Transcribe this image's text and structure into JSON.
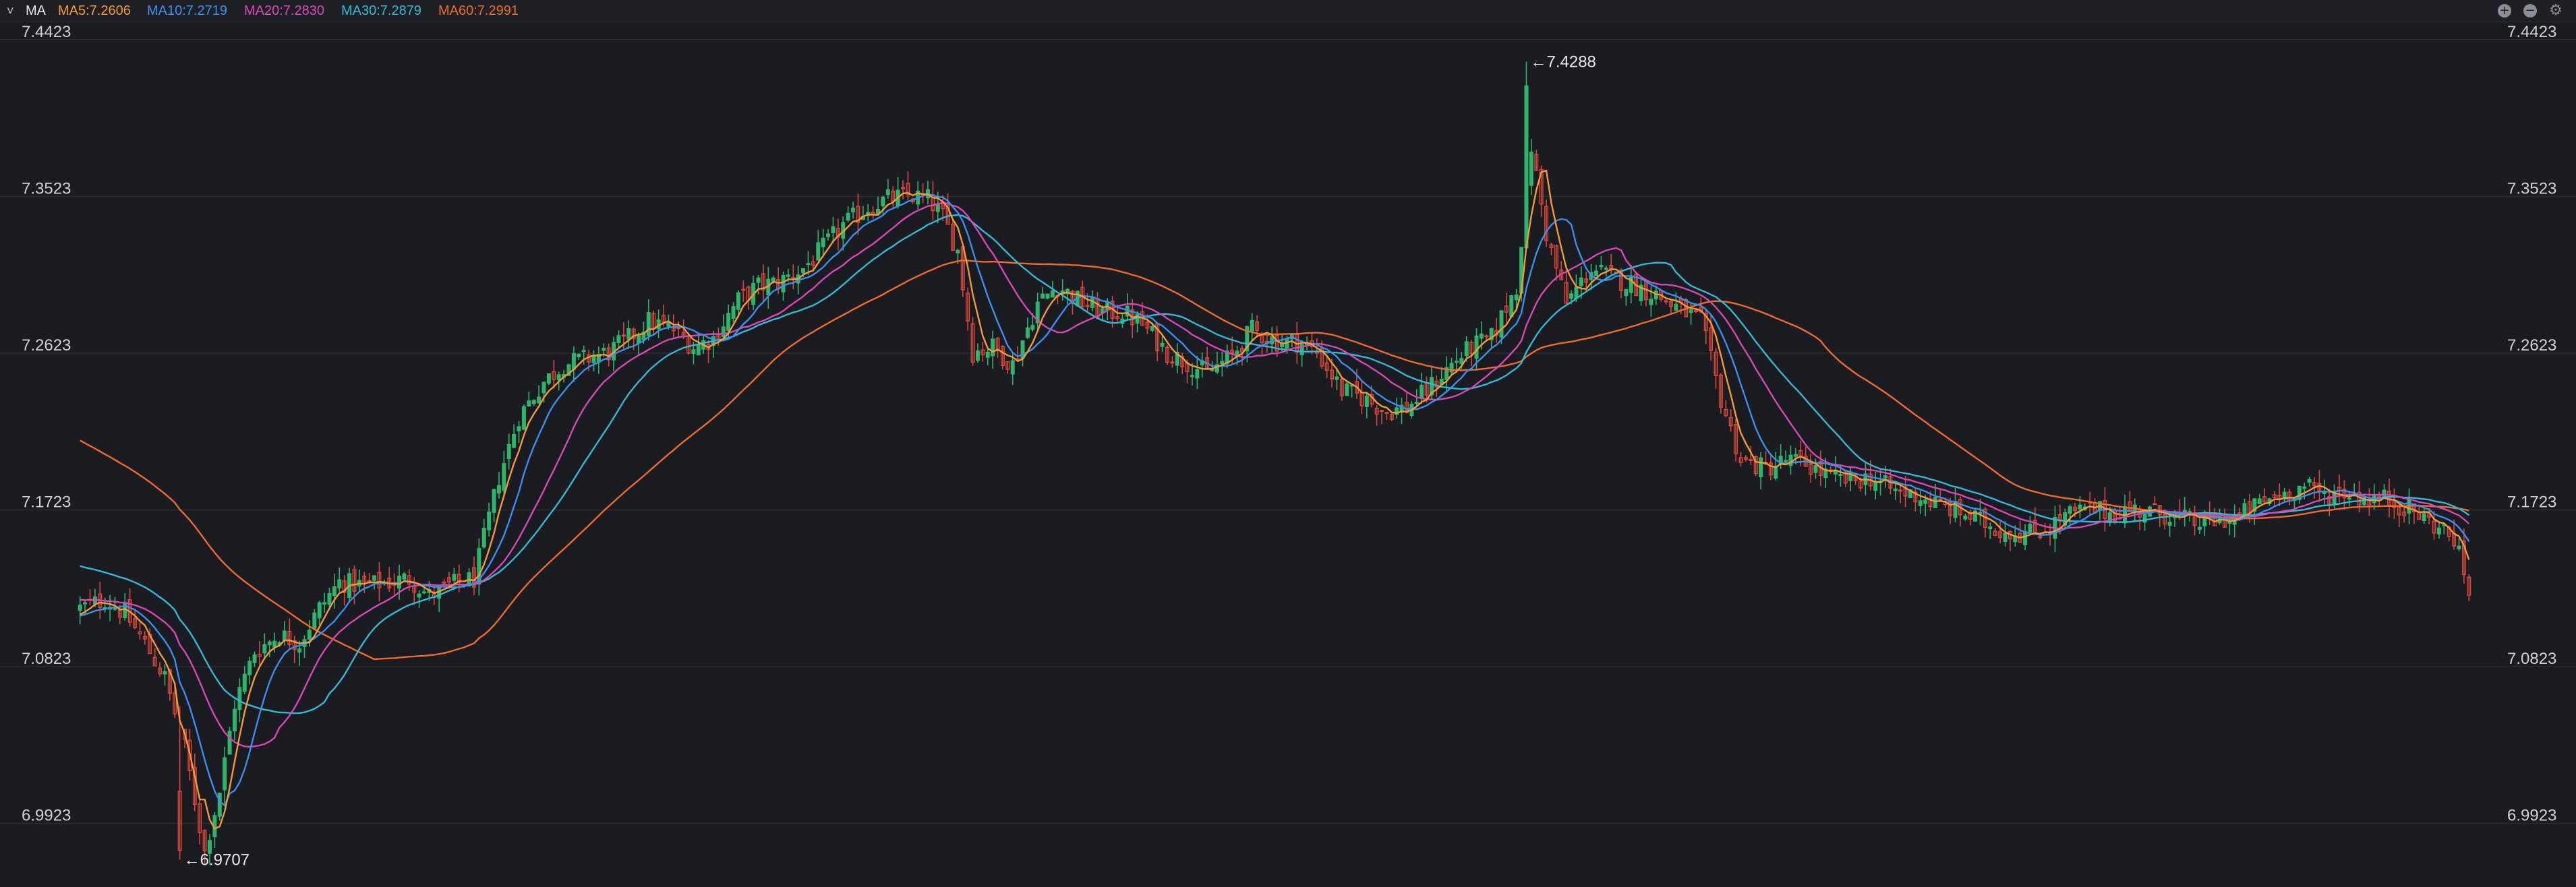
{
  "header": {
    "toggle_symbol": "˅",
    "indicator": "MA",
    "ma_values": [
      {
        "label": "MA5:7.2606",
        "color": "#f29a3a"
      },
      {
        "label": "MA10:7.2719",
        "color": "#3a8ff0"
      },
      {
        "label": "MA20:7.2830",
        "color": "#d847b8"
      },
      {
        "label": "MA30:7.2879",
        "color": "#33b8d8"
      },
      {
        "label": "MA60:7.2991",
        "color": "#ef6a2c"
      }
    ],
    "controls": [
      {
        "icon": "plus-circle-icon",
        "symbol": "+"
      },
      {
        "icon": "minus-circle-icon",
        "symbol": "−"
      },
      {
        "icon": "gear-icon",
        "symbol": "⚙"
      }
    ]
  },
  "chart_data": {
    "type": "candlestick",
    "y_ticks": [
      "7.4423",
      "7.3523",
      "7.2623",
      "7.1723",
      "7.0823",
      "6.9923"
    ],
    "ylim": [
      6.955,
      7.4515
    ],
    "grid": true,
    "up_color": "#2fb46b",
    "down_color": "#d9483b",
    "annotations": [
      {
        "label": "←7.4288",
        "x": 290,
        "y": 7.4288
      },
      {
        "label": "←6.9707",
        "x": 20,
        "y": 6.9707
      }
    ],
    "ma_colors": {
      "MA5": "#f29a3a",
      "MA10": "#3a8ff0",
      "MA20": "#d847b8",
      "MA30": "#33b8d8",
      "MA60": "#ef6a2c"
    },
    "close_anchors": [
      [
        0,
        7.115
      ],
      [
        5,
        7.12
      ],
      [
        9,
        7.112
      ],
      [
        13,
        7.095
      ],
      [
        17,
        7.075
      ],
      [
        21,
        7.035
      ],
      [
        25,
        6.975
      ],
      [
        28,
        7.01
      ],
      [
        31,
        7.06
      ],
      [
        35,
        7.09
      ],
      [
        40,
        7.1
      ],
      [
        44,
        7.095
      ],
      [
        48,
        7.115
      ],
      [
        52,
        7.13
      ],
      [
        57,
        7.128
      ],
      [
        62,
        7.13
      ],
      [
        66,
        7.132
      ],
      [
        70,
        7.122
      ],
      [
        74,
        7.128
      ],
      [
        79,
        7.132
      ],
      [
        84,
        7.19
      ],
      [
        88,
        7.225
      ],
      [
        93,
        7.245
      ],
      [
        97,
        7.255
      ],
      [
        101,
        7.258
      ],
      [
        106,
        7.262
      ],
      [
        110,
        7.27
      ],
      [
        114,
        7.28
      ],
      [
        119,
        7.275
      ],
      [
        123,
        7.265
      ],
      [
        127,
        7.27
      ],
      [
        132,
        7.292
      ],
      [
        136,
        7.3
      ],
      [
        140,
        7.302
      ],
      [
        145,
        7.31
      ],
      [
        149,
        7.322
      ],
      [
        153,
        7.335
      ],
      [
        158,
        7.345
      ],
      [
        162,
        7.35
      ],
      [
        166,
        7.352
      ],
      [
        170,
        7.35
      ],
      [
        173,
        7.34
      ],
      [
        176,
        7.32
      ],
      [
        179,
        7.262
      ],
      [
        183,
        7.265
      ],
      [
        187,
        7.255
      ],
      [
        192,
        7.29
      ],
      [
        196,
        7.3
      ],
      [
        200,
        7.292
      ],
      [
        205,
        7.285
      ],
      [
        209,
        7.285
      ],
      [
        213,
        7.278
      ],
      [
        218,
        7.262
      ],
      [
        222,
        7.256
      ],
      [
        226,
        7.25
      ],
      [
        231,
        7.26
      ],
      [
        235,
        7.275
      ],
      [
        240,
        7.268
      ],
      [
        244,
        7.268
      ],
      [
        248,
        7.262
      ],
      [
        253,
        7.24
      ],
      [
        257,
        7.236
      ],
      [
        262,
        7.228
      ],
      [
        266,
        7.23
      ],
      [
        270,
        7.24
      ],
      [
        275,
        7.255
      ],
      [
        279,
        7.265
      ],
      [
        283,
        7.27
      ],
      [
        288,
        7.3
      ],
      [
        291,
        7.38
      ],
      [
        294,
        7.33
      ],
      [
        298,
        7.29
      ],
      [
        303,
        7.31
      ],
      [
        307,
        7.305
      ],
      [
        312,
        7.3
      ],
      [
        316,
        7.295
      ],
      [
        320,
        7.288
      ],
      [
        325,
        7.28
      ],
      [
        329,
        7.235
      ],
      [
        333,
        7.2
      ],
      [
        338,
        7.195
      ],
      [
        342,
        7.2
      ],
      [
        346,
        7.198
      ],
      [
        351,
        7.19
      ],
      [
        355,
        7.188
      ],
      [
        359,
        7.19
      ],
      [
        364,
        7.182
      ],
      [
        368,
        7.18
      ],
      [
        372,
        7.175
      ],
      [
        377,
        7.17
      ],
      [
        381,
        7.165
      ],
      [
        385,
        7.16
      ],
      [
        390,
        7.158
      ],
      [
        394,
        7.16
      ],
      [
        398,
        7.168
      ],
      [
        403,
        7.172
      ],
      [
        407,
        7.17
      ],
      [
        411,
        7.172
      ],
      [
        416,
        7.17
      ],
      [
        420,
        7.168
      ],
      [
        424,
        7.164
      ],
      [
        428,
        7.165
      ],
      [
        433,
        7.168
      ],
      [
        437,
        7.175
      ],
      [
        441,
        7.18
      ],
      [
        446,
        7.185
      ],
      [
        450,
        7.18
      ],
      [
        454,
        7.182
      ],
      [
        458,
        7.178
      ],
      [
        462,
        7.178
      ],
      [
        467,
        7.172
      ],
      [
        471,
        7.165
      ],
      [
        476,
        7.155
      ],
      [
        479,
        7.125
      ]
    ],
    "ma60_start": 7.213
  }
}
